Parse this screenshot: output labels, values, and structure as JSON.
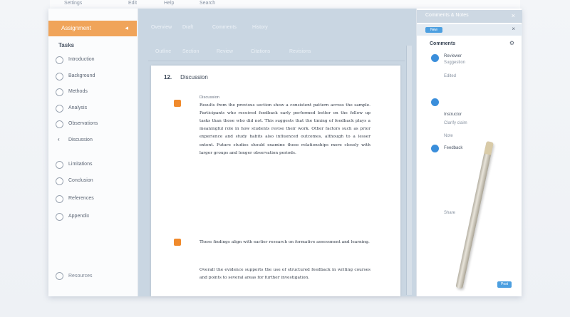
{
  "topbar": {
    "items": [
      "Settings",
      "Edit",
      "Help",
      "Search"
    ]
  },
  "sidebar": {
    "header": "Assignment",
    "close": "◂",
    "title": "Tasks",
    "items": [
      {
        "label": "Introduction",
        "active": false
      },
      {
        "label": "Background",
        "active": false
      },
      {
        "label": "Methods",
        "active": false
      },
      {
        "label": "Analysis",
        "active": false
      },
      {
        "label": "Observations",
        "active": false
      },
      {
        "label": "Discussion",
        "active": true
      },
      {
        "label": "Limitations",
        "active": false
      },
      {
        "label": "Conclusion",
        "active": false
      },
      {
        "label": "References",
        "active": false
      },
      {
        "label": "Appendix",
        "active": false
      }
    ],
    "footer": "Resources"
  },
  "main": {
    "tabs": [
      "Overview",
      "Draft",
      "Comments",
      "History"
    ],
    "subtabs": [
      "Outline",
      "Section",
      "Review",
      "Citations",
      "Revisions"
    ],
    "doc": {
      "number": "12.",
      "title": "Discussion",
      "section_heading": "Discussion",
      "paragraphs": [
        "Results from the previous section show a consistent pattern across the sample. Participants who received feedback early performed better on the follow up tasks than those who did not. This suggests that the timing of feedback plays a meaningful role in how students revise their work. Other factors such as prior experience and study habits also influenced outcomes, although to a lesser extent. Future studies should examine these relationships more closely with larger groups and longer observation periods.",
        "These findings align with earlier research on formative assessment and learning.",
        "Overall the evidence supports the use of structured feedback in writing courses and points to several areas for further investigation."
      ]
    }
  },
  "rpanel": {
    "header": "Comments & Notes",
    "close": "×",
    "button": "New",
    "sub_close": "×",
    "title": "Comments",
    "gear": "⚙",
    "entries": [
      {
        "name": "Reviewer",
        "text": "Suggestion"
      },
      {
        "name": "",
        "text": "Edited"
      },
      {
        "name": "Instructor",
        "text": "Clarify claim"
      },
      {
        "name": "",
        "text": "Note"
      },
      {
        "name": "Feedback",
        "text": ""
      }
    ],
    "side_note": "Share",
    "badge": "Post"
  },
  "colors": {
    "accent": "#f0a45a",
    "blue": "#3a8edb",
    "main_bg": "#c9d6e2"
  }
}
